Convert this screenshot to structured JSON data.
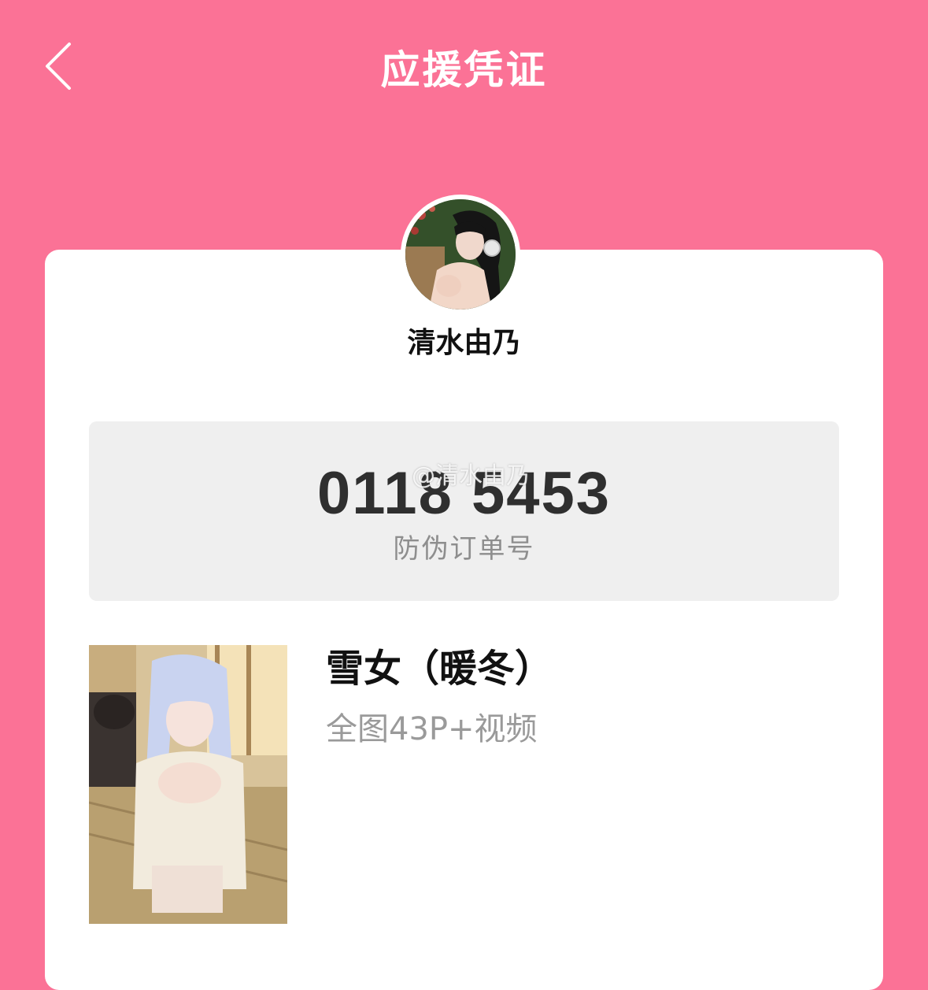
{
  "header": {
    "title": "应援凭证",
    "back_icon": "chevron-left-icon"
  },
  "creator": {
    "name": "清水由乃"
  },
  "order": {
    "number": "0118 5453",
    "label": "防伪订单号",
    "watermark": "@清水由乃"
  },
  "product": {
    "title": "雪女（暖冬）",
    "subtitle": "全图43P+视频"
  },
  "colors": {
    "background": "#FB7296",
    "card": "#FFFFFF",
    "code_box": "#EFEFEF",
    "order_number": "#2F2F2F",
    "muted_text": "#8E8E8E"
  }
}
